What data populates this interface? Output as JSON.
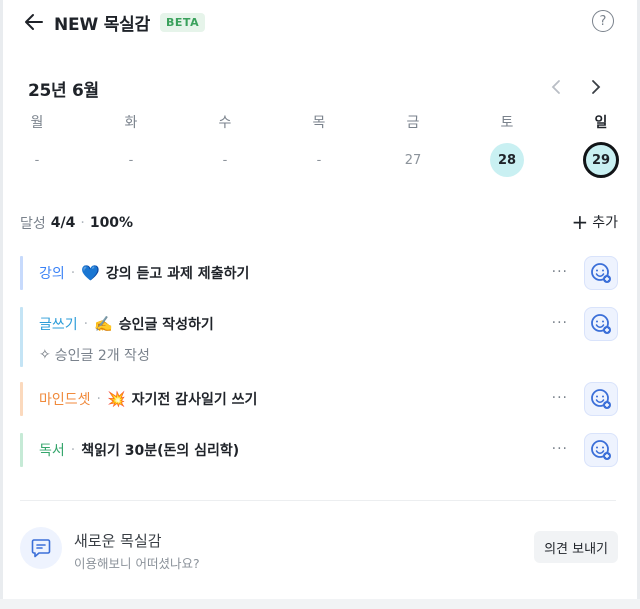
{
  "header": {
    "title": "NEW 목실감",
    "badge": "BETA"
  },
  "calendar": {
    "month_label": "25년 6월",
    "weekdays": [
      "월",
      "화",
      "수",
      "목",
      "금",
      "토",
      "일"
    ],
    "dates": [
      "-",
      "-",
      "-",
      "-",
      "27",
      "28",
      "29"
    ],
    "selected_date": "29"
  },
  "summary": {
    "label": "달성",
    "count": "4/4",
    "separator": "·",
    "percent": "100%",
    "add_label": "추가"
  },
  "goals": [
    {
      "category": "강의",
      "category_color": "#3b82f6",
      "emoji": "💙",
      "text": "강의 듣고 과제 제출하기",
      "sub": ""
    },
    {
      "category": "글쓰기",
      "category_color": "#2b9cd8",
      "emoji": "✍️",
      "text": "승인글 작성하기",
      "sub": "승인글 2개 작성"
    },
    {
      "category": "마인드셋",
      "category_color": "#f08a3c",
      "emoji": "💥",
      "text": "자기전 감사일기 쓰기",
      "sub": ""
    },
    {
      "category": "독서",
      "category_color": "#34a56b",
      "emoji": "",
      "text": "책읽기 30분(돈의 심리학)",
      "sub": ""
    }
  ],
  "feedback": {
    "title": "새로운 목실감",
    "subtitle": "이용해보니 어떠셨나요?",
    "button_label": "의견 보내기"
  }
}
